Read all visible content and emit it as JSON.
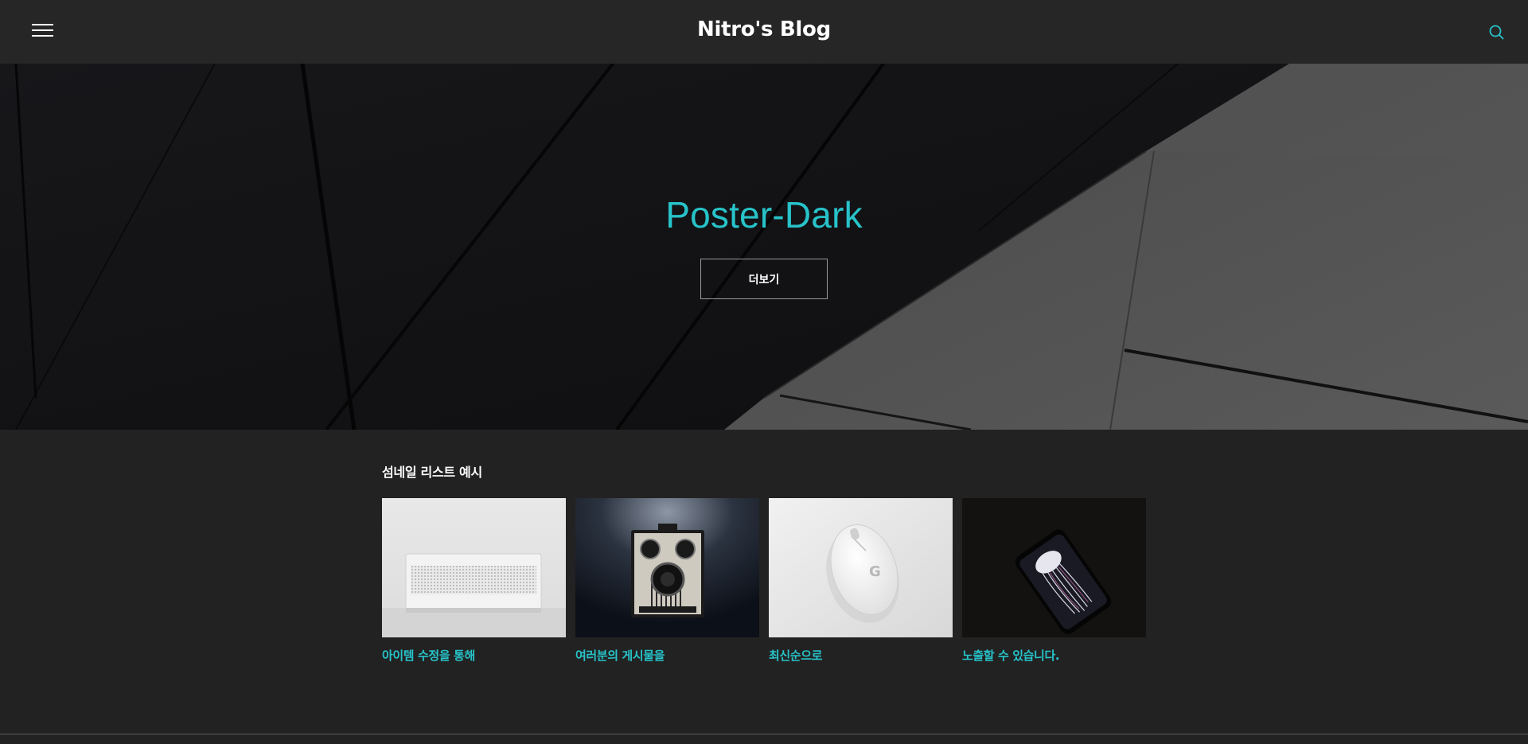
{
  "header": {
    "title": "Nitro's Blog",
    "menu_icon": "hamburger-menu-icon",
    "search_icon": "search-icon"
  },
  "hero": {
    "title": "Poster-Dark",
    "button_label": "더보기"
  },
  "thumbnail_section": {
    "title": "섬네일 리스트 예시",
    "items": [
      {
        "caption": "아이템 수정을 통해",
        "image": "white-speaker-photo"
      },
      {
        "caption": "여러분의 게시물을",
        "image": "vintage-camera-photo"
      },
      {
        "caption": "최신순으로",
        "image": "white-mouse-photo"
      },
      {
        "caption": "노출할 수 있습니다.",
        "image": "smartphone-jellyfish-photo"
      }
    ]
  },
  "colors": {
    "accent": "#27c3c9",
    "background": "#222222",
    "header_bg": "#262626"
  }
}
